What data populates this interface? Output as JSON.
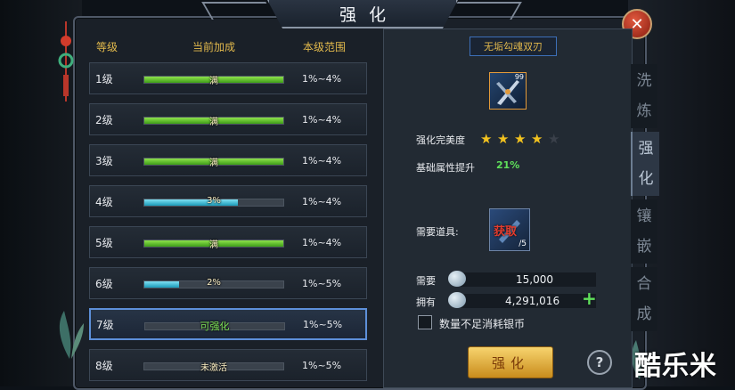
{
  "title": "强化",
  "close_icon": "close-icon",
  "left": {
    "headers": {
      "level": "等级",
      "current": "当前加成",
      "range": "本级范围"
    },
    "rows": [
      {
        "level": "1级",
        "fill": 1.0,
        "color": "green",
        "bar_text": "满",
        "range": "1%~4%"
      },
      {
        "level": "2级",
        "fill": 1.0,
        "color": "green",
        "bar_text": "满",
        "range": "1%~4%"
      },
      {
        "level": "3级",
        "fill": 1.0,
        "color": "green",
        "bar_text": "满",
        "range": "1%~4%"
      },
      {
        "level": "4级",
        "fill": 0.67,
        "color": "blue",
        "bar_text": "3%",
        "range": "1%~4%"
      },
      {
        "level": "5级",
        "fill": 1.0,
        "color": "green",
        "bar_text": "满",
        "range": "1%~4%"
      },
      {
        "level": "6级",
        "fill": 0.25,
        "color": "blue",
        "bar_text": "2%",
        "range": "1%~5%"
      },
      {
        "level": "7级",
        "fill": 0,
        "color": "none",
        "bar_text": "可强化",
        "range": "1%~5%"
      },
      {
        "level": "8级",
        "fill": 0,
        "color": "none",
        "bar_text": "未激活",
        "range": "1%~5%"
      }
    ]
  },
  "right": {
    "item_name": "无垢勾魂双刃",
    "item_level_badge": "99",
    "perfection_label": "强化完美度",
    "stars_total": 5,
    "stars_filled": 4,
    "base_attr_label": "基础属性提升",
    "base_attr_value": "21%",
    "need_item_label": "需要道具:",
    "need_item_get": "获取",
    "need_item_count": "/5",
    "need_label": "需要",
    "need_value": "15,000",
    "have_label": "拥有",
    "have_value": "4,291,016",
    "checkbox_label": "数量不足消耗银币",
    "enhance_button": "强化",
    "help_icon": "?"
  },
  "side_tabs": [
    {
      "label": "洗炼",
      "active": false
    },
    {
      "label": "强化",
      "active": true
    },
    {
      "label": "镶嵌",
      "active": false
    },
    {
      "label": "合成",
      "active": false
    }
  ],
  "watermark": "酷乐米",
  "colors": {
    "bar_green": "#5cc22a",
    "bar_blue": "#28a8c8",
    "gold_text": "#e2b94c",
    "active_row_border": "#5d8fd8"
  }
}
